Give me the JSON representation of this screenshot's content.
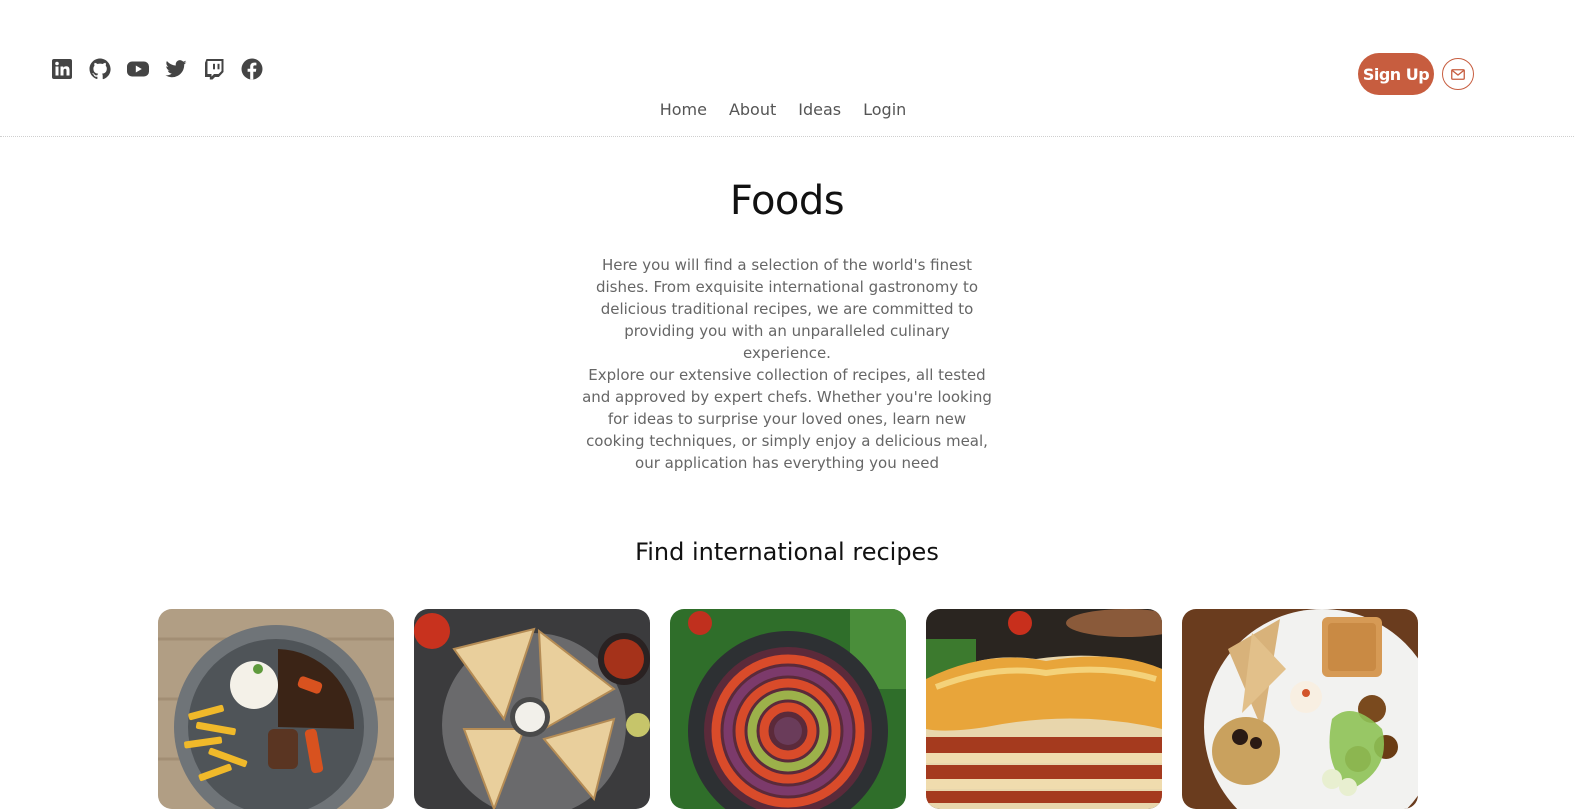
{
  "socials": [
    {
      "name": "linkedin-icon",
      "label": "LinkedIn"
    },
    {
      "name": "github-icon",
      "label": "GitHub"
    },
    {
      "name": "youtube-icon",
      "label": "YouTube"
    },
    {
      "name": "twitter-icon",
      "label": "Twitter"
    },
    {
      "name": "twitch-icon",
      "label": "Twitch"
    },
    {
      "name": "facebook-icon",
      "label": "Facebook"
    }
  ],
  "nav": {
    "home": "Home",
    "about": "About",
    "ideas": "Ideas",
    "login": "Login"
  },
  "actions": {
    "signup": "Sign Up",
    "mail_icon": "mail-icon"
  },
  "hero": {
    "title": "Foods",
    "paragraph1": "Here you will find a selection of the world's finest dishes. From exquisite international gastronomy to delicious traditional recipes, we are committed to providing you with an unparalleled culinary experience.",
    "paragraph2": "Explore our extensive collection of recipes, all tested and approved by expert chefs. Whether you're looking for ideas to surprise your loved ones, learn new cooking techniques, or simply enjoy a delicious meal, our application has everything you need"
  },
  "recipes": {
    "heading": "Find international recipes"
  },
  "colors": {
    "accent": "#c75d3f",
    "icon": "#444444",
    "text_muted": "#666666"
  }
}
